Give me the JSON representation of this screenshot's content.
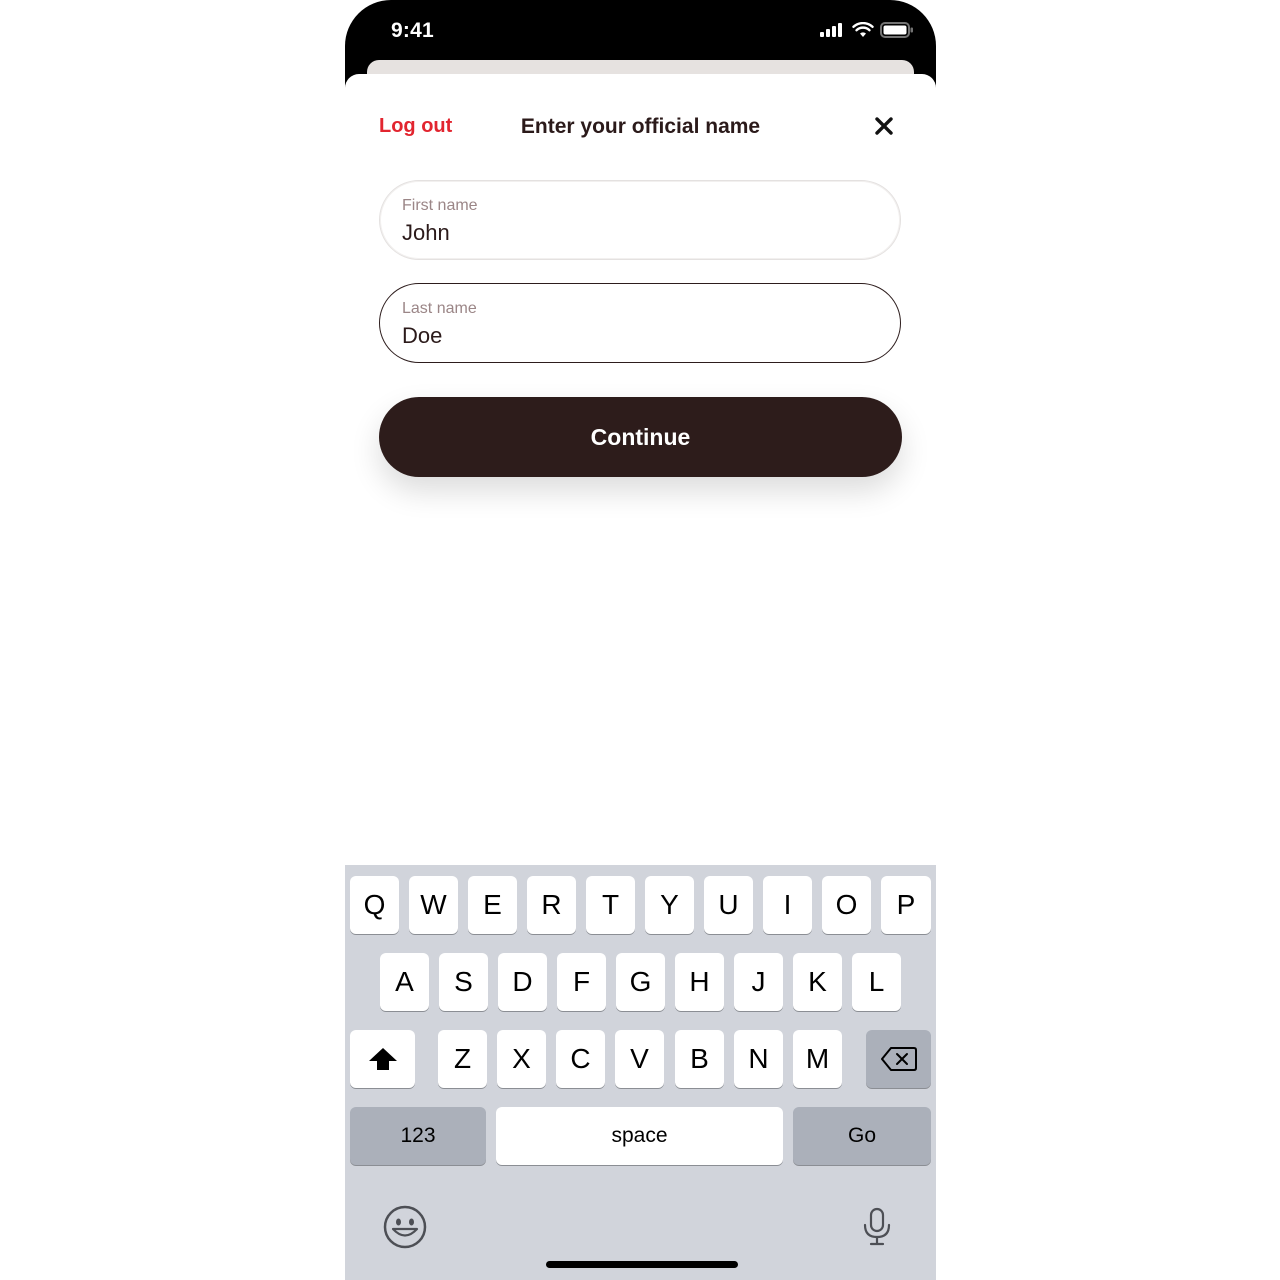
{
  "status_bar": {
    "time": "9:41",
    "icons": [
      "cellular-signal-icon",
      "wifi-icon",
      "battery-icon"
    ]
  },
  "header": {
    "logout_label": "Log out",
    "title": "Enter your official name",
    "close_icon": "close-icon"
  },
  "form": {
    "first_name": {
      "label": "First name",
      "value": "John"
    },
    "last_name": {
      "label": "Last name",
      "value": "Doe"
    },
    "continue_label": "Continue"
  },
  "keyboard": {
    "row1": [
      "Q",
      "W",
      "E",
      "R",
      "T",
      "Y",
      "U",
      "I",
      "O",
      "P"
    ],
    "row2": [
      "A",
      "S",
      "D",
      "F",
      "G",
      "H",
      "J",
      "K",
      "L"
    ],
    "row3": [
      "Z",
      "X",
      "C",
      "V",
      "B",
      "N",
      "M"
    ],
    "numbers_label": "123",
    "space_label": "space",
    "go_label": "Go",
    "icons": [
      "shift-icon",
      "backspace-icon",
      "emoji-icon",
      "microphone-icon"
    ]
  },
  "colors": {
    "accent": "#e2252f",
    "primary_dark": "#2d1c1b",
    "keyboard_bg": "#d1d4db"
  }
}
